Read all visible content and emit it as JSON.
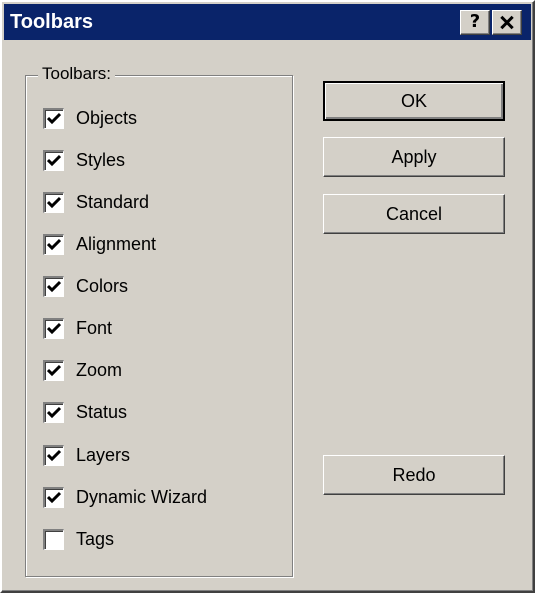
{
  "window": {
    "title": "Toolbars",
    "help_label": "?",
    "titlebar_color": "#0a246a",
    "face_color": "#d4d0c8"
  },
  "group": {
    "label": "Toolbars:",
    "items": [
      {
        "label": "Objects",
        "checked": true
      },
      {
        "label": "Styles",
        "checked": true
      },
      {
        "label": "Standard",
        "checked": true
      },
      {
        "label": "Alignment",
        "checked": true
      },
      {
        "label": "Colors",
        "checked": true
      },
      {
        "label": "Font",
        "checked": true
      },
      {
        "label": "Zoom",
        "checked": true
      },
      {
        "label": "Status",
        "checked": true
      },
      {
        "label": "Layers",
        "checked": true
      },
      {
        "label": "Dynamic Wizard",
        "checked": true
      },
      {
        "label": "Tags",
        "checked": false
      }
    ]
  },
  "buttons": {
    "ok": "OK",
    "apply": "Apply",
    "cancel": "Cancel",
    "redo": "Redo"
  }
}
